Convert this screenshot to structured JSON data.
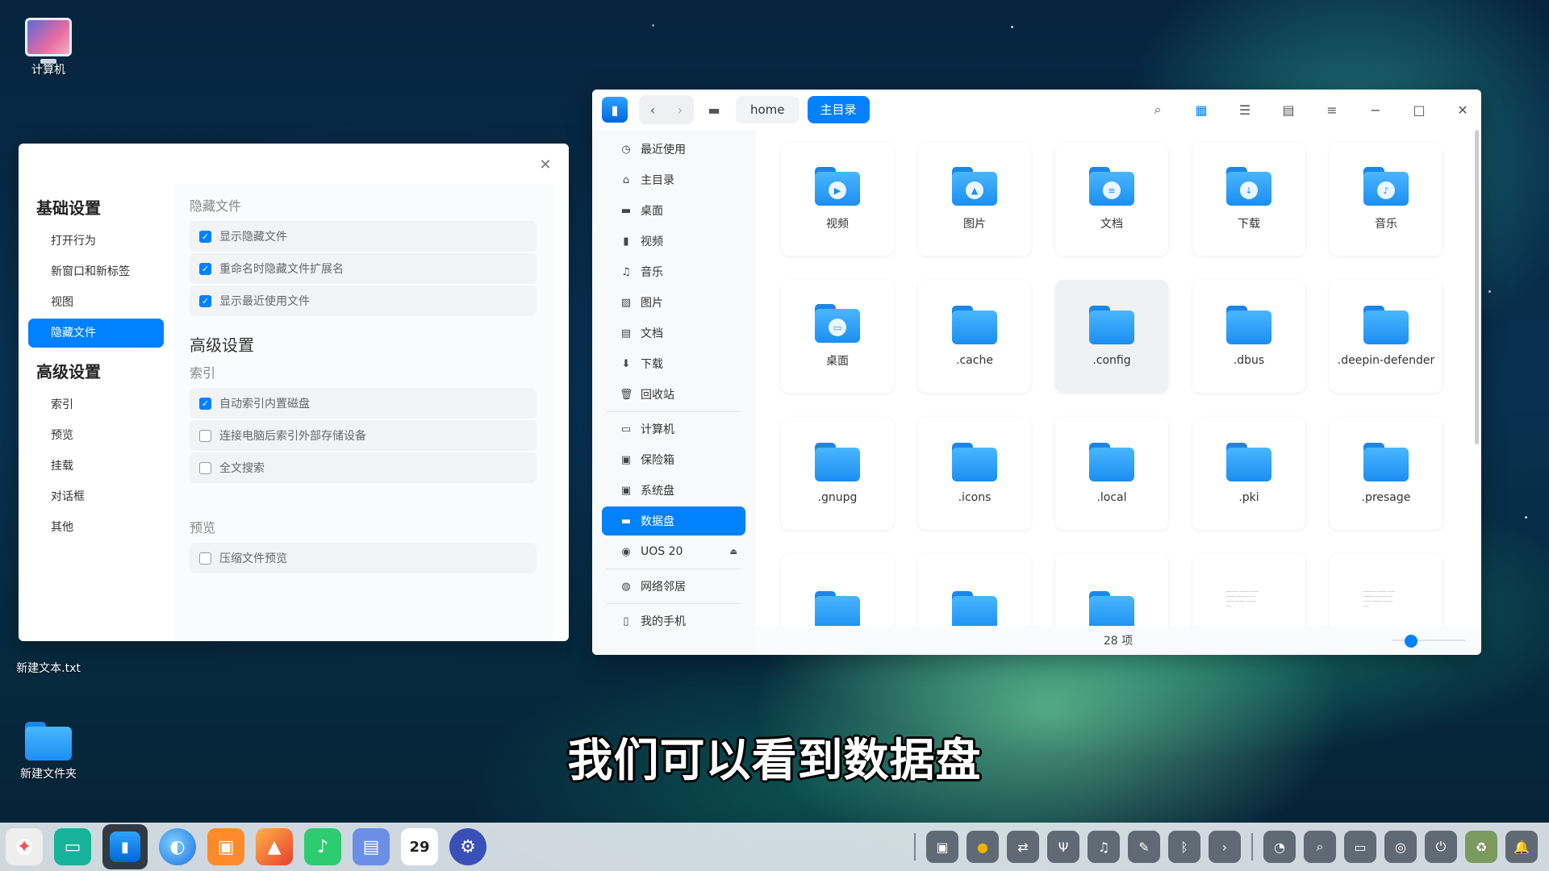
{
  "desktop": {
    "icons": [
      {
        "label": "计算机"
      },
      {
        "label": "新建文本.txt"
      },
      {
        "label": "新建文件夹"
      }
    ]
  },
  "settings": {
    "close_icon": "close-icon",
    "nav": {
      "group1": "基础设置",
      "items1": [
        "打开行为",
        "新窗口和新标签",
        "视图",
        "隐藏文件"
      ],
      "group2": "高级设置",
      "items2": [
        "索引",
        "预览",
        "挂载",
        "对话框",
        "其他"
      ],
      "active": "隐藏文件"
    },
    "content": {
      "hidden_title": "隐藏文件",
      "hidden_opts": [
        {
          "label": "显示隐藏文件",
          "checked": true
        },
        {
          "label": "重命名时隐藏文件扩展名",
          "checked": true
        },
        {
          "label": "显示最近使用文件",
          "checked": true
        }
      ],
      "advanced_title": "高级设置",
      "index_title": "索引",
      "index_opts": [
        {
          "label": "自动索引内置磁盘",
          "checked": true
        },
        {
          "label": "连接电脑后索引外部存储设备",
          "checked": false
        },
        {
          "label": "全文搜索",
          "checked": false
        }
      ],
      "preview_title": "预览",
      "preview_opts": [
        {
          "label": "压缩文件预览",
          "checked": false
        }
      ]
    }
  },
  "filemanager": {
    "breadcrumb": [
      "home",
      "主目录"
    ],
    "sidebar": [
      {
        "label": "最近使用",
        "icon": "clock-icon"
      },
      {
        "label": "主目录",
        "icon": "home-icon"
      },
      {
        "label": "桌面",
        "icon": "desktop-icon"
      },
      {
        "label": "视频",
        "icon": "video-icon"
      },
      {
        "label": "音乐",
        "icon": "music-icon"
      },
      {
        "label": "图片",
        "icon": "picture-icon"
      },
      {
        "label": "文档",
        "icon": "document-icon"
      },
      {
        "label": "下载",
        "icon": "download-icon"
      },
      {
        "label": "回收站",
        "icon": "trash-icon"
      },
      {
        "label": "计算机",
        "icon": "computer-icon"
      },
      {
        "label": "保险箱",
        "icon": "vault-icon"
      },
      {
        "label": "系统盘",
        "icon": "system-disk-icon"
      },
      {
        "label": "数据盘",
        "icon": "data-disk-icon"
      },
      {
        "label": "UOS 20",
        "icon": "disc-icon"
      },
      {
        "label": "网络邻居",
        "icon": "network-icon"
      },
      {
        "label": "我的手机",
        "icon": "phone-icon"
      }
    ],
    "active_sidebar": "数据盘",
    "files": [
      {
        "name": "视频",
        "badge": "▶"
      },
      {
        "name": "图片",
        "badge": "▲"
      },
      {
        "name": "文档",
        "badge": "≡"
      },
      {
        "name": "下载",
        "badge": "↓"
      },
      {
        "name": "音乐",
        "badge": "♪"
      },
      {
        "name": "桌面",
        "badge": "▭"
      },
      {
        "name": ".cache",
        "badge": ""
      },
      {
        "name": ".config",
        "badge": ""
      },
      {
        "name": ".dbus",
        "badge": ""
      },
      {
        "name": ".deepin-defender",
        "badge": ""
      },
      {
        "name": ".gnupg",
        "badge": ""
      },
      {
        "name": ".icons",
        "badge": ""
      },
      {
        "name": ".local",
        "badge": ""
      },
      {
        "name": ".pki",
        "badge": ""
      },
      {
        "name": ".presage",
        "badge": ""
      }
    ],
    "hovered_file": ".config",
    "status": "28 项",
    "zoom_level": 0.2
  },
  "subtitle": "我们可以看到数据盘",
  "dock": {
    "date_day": "29"
  }
}
